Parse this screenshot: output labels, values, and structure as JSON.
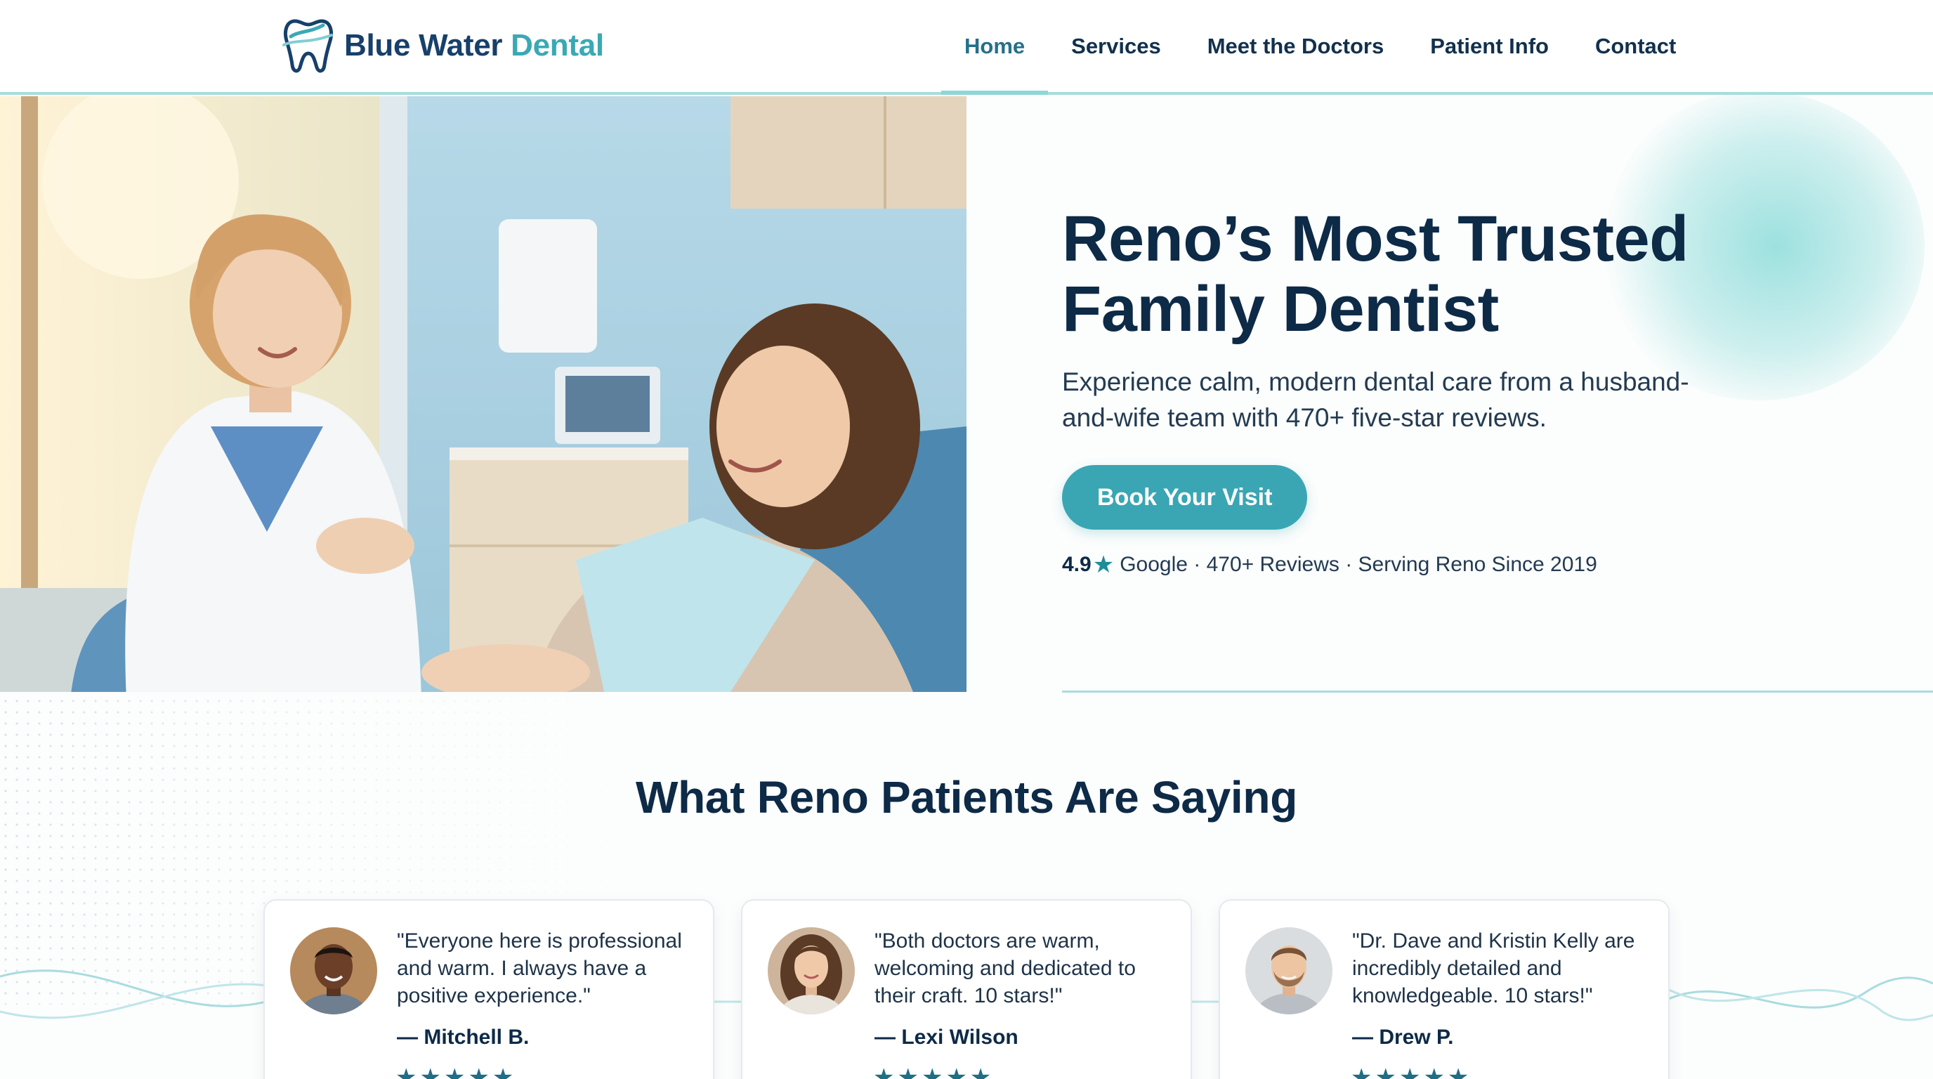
{
  "brand": {
    "name_part1": "Blue Water",
    "name_part2": "Dental",
    "icon": "tooth-logo-icon",
    "colors": {
      "navy": "#17406a",
      "teal": "#3aa9b4"
    }
  },
  "nav": {
    "items": [
      {
        "label": "Home",
        "active": true
      },
      {
        "label": "Services",
        "active": false
      },
      {
        "label": "Meet the Doctors",
        "active": false
      },
      {
        "label": "Patient Info",
        "active": false
      },
      {
        "label": "Contact",
        "active": false
      }
    ]
  },
  "hero": {
    "title_line1": "Reno’s Most Trusted",
    "title_line2": "Family Dentist",
    "subtitle": "Experience calm, modern dental care from a husband-and-wife team with 470+ five-star reviews.",
    "cta_label": "Book Your Visit",
    "rating": {
      "score": "4.9",
      "star_icon": "star-icon",
      "details": "Google · 470+ Reviews · Serving Reno Since 2019"
    }
  },
  "testimonials": {
    "title": "What Reno Patients Are Saying",
    "cards": [
      {
        "quote": "\"Everyone here is professional and warm. I always have a positive experience.\"",
        "author": "— Mitchell B.",
        "stars": "★★★★★",
        "rating": 5
      },
      {
        "quote": "\"Both doctors are warm, welcoming and dedicated to their craft. 10 stars!\"",
        "author": "— Lexi Wilson",
        "stars": "★★★★★",
        "rating": 5
      },
      {
        "quote": "\"Dr. Dave and Kristin Kelly are incredibly detailed and knowledgeable. 10 stars!\"",
        "author": "— Drew P.",
        "stars": "★★★★★",
        "rating": 5
      }
    ]
  },
  "colors": {
    "accent": "#3aa6b4",
    "heading": "#0d2a47",
    "divider": "#a8dcdc"
  }
}
